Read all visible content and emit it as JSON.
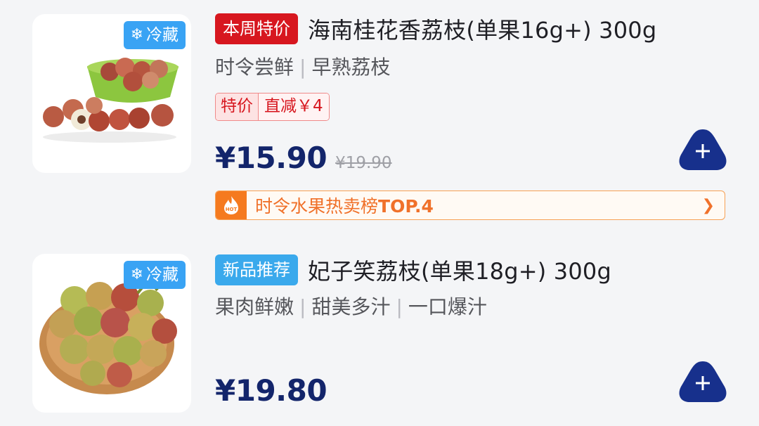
{
  "products": [
    {
      "storage_badge": {
        "icon": "snowflake-icon",
        "label": "冷藏"
      },
      "tag": "本周特价",
      "title": "海南桂花香荔枝(单果16g+) 300g",
      "subtitle_parts": [
        "时令尝鲜",
        "早熟荔枝"
      ],
      "promo": {
        "label": "特价",
        "discount": "直减￥4"
      },
      "price": "¥15.90",
      "original_price": "¥19.90",
      "ranking": {
        "prefix": "时令水果热卖榜",
        "rank": "TOP.4",
        "icon": "hot-icon"
      },
      "add_button": {
        "icon": "plus-icon"
      }
    },
    {
      "storage_badge": {
        "icon": "snowflake-icon",
        "label": "冷藏"
      },
      "tag": "新品推荐",
      "title": "妃子笑荔枝(单果18g+) 300g",
      "subtitle_parts": [
        "果肉鲜嫩",
        "甜美多汁",
        "一口爆汁"
      ],
      "price": "¥19.80",
      "add_button": {
        "icon": "plus-icon"
      }
    }
  ],
  "colors": {
    "price": "#13256b",
    "tag_red": "#d7171f",
    "tag_blue": "#3aa9ec",
    "cold_badge": "#39a3f4",
    "rank_orange": "#f57a1f",
    "add_button": "#17308c"
  }
}
